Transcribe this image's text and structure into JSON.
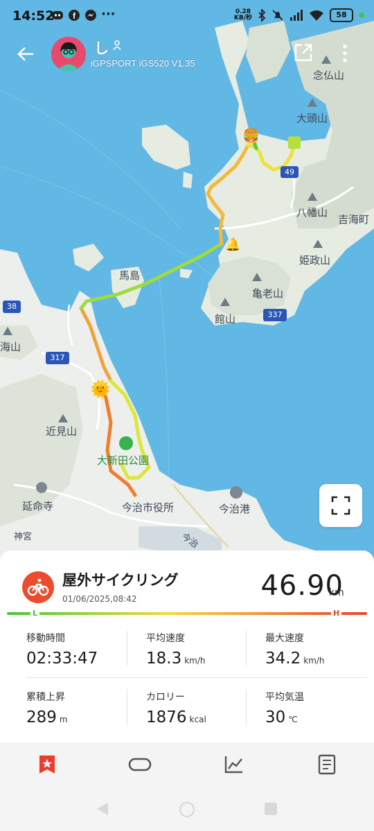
{
  "status_bar": {
    "time": "14:52",
    "net_speed_value": "0.28",
    "net_speed_unit": "KB/秒",
    "battery": "58",
    "more": "···"
  },
  "header": {
    "user_name": "し",
    "device": "iGPSPORT iGS520  V1.35"
  },
  "map": {
    "labels": {
      "nenbutsu": "念仏山",
      "daito": "大頭山",
      "route49": "49",
      "hachiman": "八幡山",
      "yoshiumi": "吉海町",
      "himemasa": "姫政山",
      "uma": "馬島",
      "kamero": "亀老山",
      "tate": "館山",
      "route337": "337",
      "route38": "38",
      "umi": "海山",
      "route317": "317",
      "chikami": "近見山",
      "park": "大新田公園",
      "enmei": "延命寺",
      "city_hall": "今治市役所",
      "port": "今治港",
      "jingu": "神宮",
      "imabari": "今治"
    }
  },
  "activity": {
    "title": "屋外サイクリング",
    "datetime": "01/06/2025,08:42",
    "distance": "46.90",
    "distance_unit": "km",
    "bar_low": "L",
    "bar_high": "H"
  },
  "stats": [
    {
      "label": "移動時間",
      "value": "02:33:47",
      "unit": ""
    },
    {
      "label": "平均速度",
      "value": "18.3",
      "unit": "km/h"
    },
    {
      "label": "最大速度",
      "value": "34.2",
      "unit": "km/h"
    },
    {
      "label": "累積上昇",
      "value": "289",
      "unit": "m"
    },
    {
      "label": "カロリー",
      "value": "1876",
      "unit": "kcal"
    },
    {
      "label": "平均気温",
      "value": "30",
      "unit": "℃"
    }
  ],
  "colors": {
    "accent": "#ee4a2c",
    "water": "#62b8e4",
    "land": "#eef0ec",
    "hill": "#d5ddd2"
  },
  "nav_icons": [
    "star-bookmark-icon",
    "loop-icon",
    "chart-icon",
    "document-icon"
  ]
}
